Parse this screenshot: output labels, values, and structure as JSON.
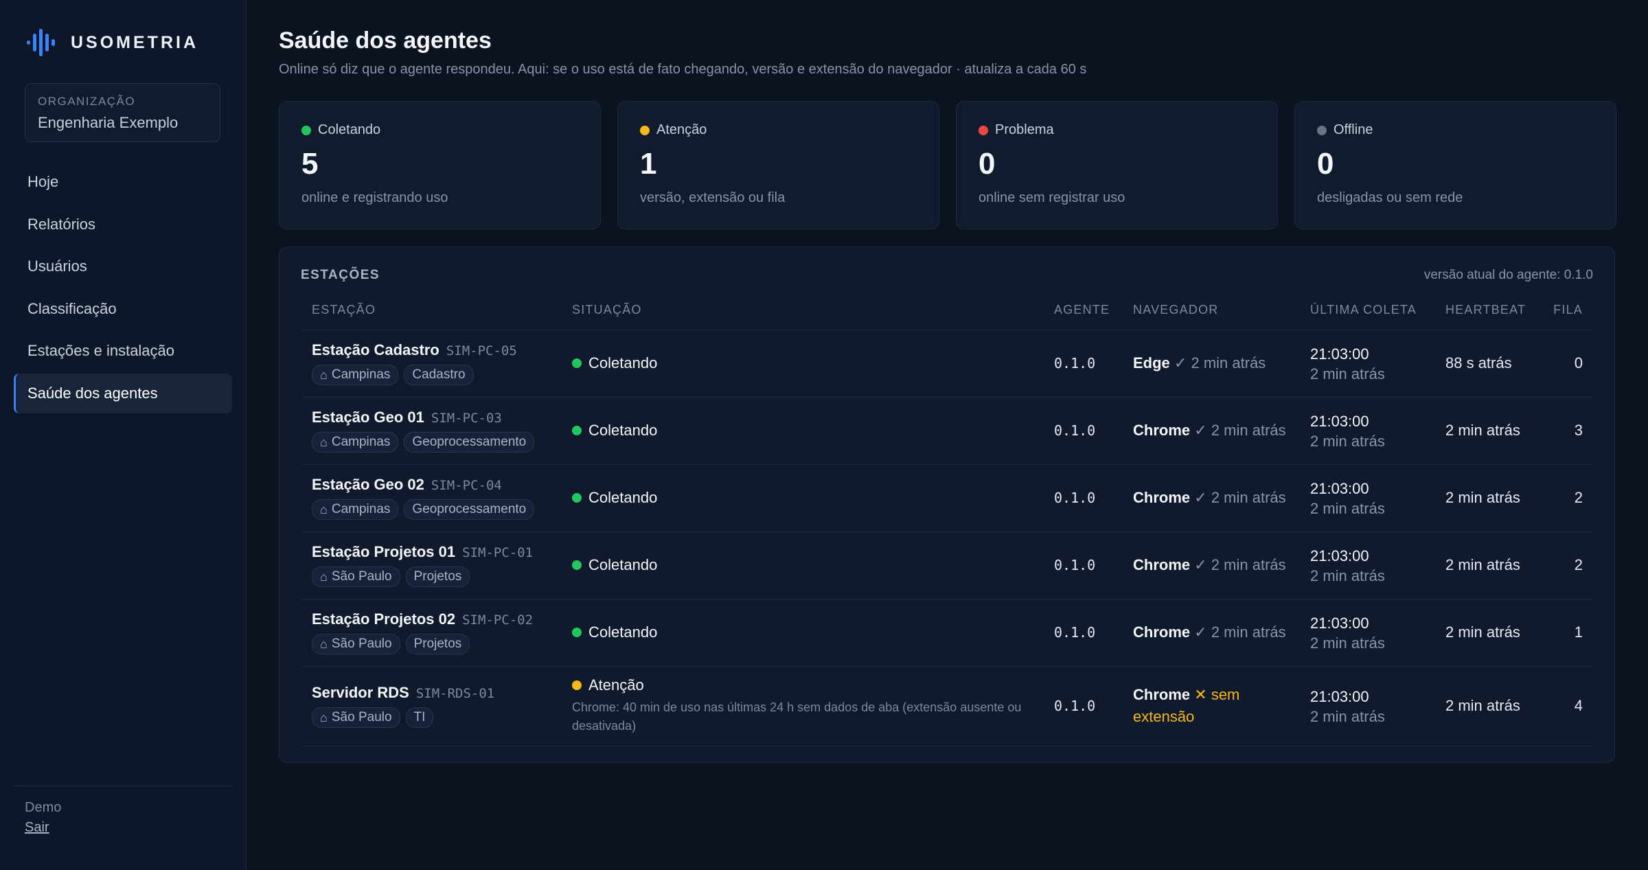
{
  "brand": {
    "name": "USOMETRIA",
    "icon": "audio-bars-icon",
    "accent": "#3b82f6"
  },
  "org": {
    "label": "ORGANIZAÇÃO",
    "name": "Engenharia Exemplo"
  },
  "nav": {
    "items": [
      {
        "label": "Hoje"
      },
      {
        "label": "Relatórios"
      },
      {
        "label": "Usuários"
      },
      {
        "label": "Classificação"
      },
      {
        "label": "Estações e instalação"
      },
      {
        "label": "Saúde dos agentes"
      }
    ],
    "active_index": 5
  },
  "footer": {
    "demo": "Demo",
    "logout": "Sair"
  },
  "page": {
    "title": "Saúde dos agentes",
    "subtitle": "Online só diz que o agente respondeu. Aqui: se o uso está de fato chegando, versão e extensão do navegador · atualiza a cada 60 s"
  },
  "cards": [
    {
      "label": "Coletando",
      "value": "5",
      "desc": "online e registrando uso",
      "color": "#22c55e"
    },
    {
      "label": "Atenção",
      "value": "1",
      "desc": "versão, extensão ou fila",
      "color": "#f5b918"
    },
    {
      "label": "Problema",
      "value": "0",
      "desc": "online sem registrar uso",
      "color": "#ef4444"
    },
    {
      "label": "Offline",
      "value": "0",
      "desc": "desligadas ou sem rede",
      "color": "#6b7280"
    }
  ],
  "table": {
    "title": "ESTAÇÕES",
    "version_note": "versão atual do agente: 0.1.0",
    "headers": {
      "station": "ESTAÇÃO",
      "status": "SITUAÇÃO",
      "agent": "AGENTE",
      "browser": "NAVEGADOR",
      "last": "ÚLTIMA COLETA",
      "heartbeat": "HEARTBEAT",
      "queue": "FILA"
    },
    "rows": [
      {
        "name": "Estação Cadastro",
        "code": "SIM-PC-05",
        "location": "Campinas",
        "dept": "Cadastro",
        "status": "Coletando",
        "status_color": "#22c55e",
        "note": "",
        "agent": "0.1.0",
        "browser": "Edge",
        "browser_mark": "✓",
        "browser_detail": "2 min atrás",
        "browser_warn": false,
        "last_time": "21:03:00",
        "last_ago": "2 min atrás",
        "heartbeat": "88 s atrás",
        "queue": "0"
      },
      {
        "name": "Estação Geo 01",
        "code": "SIM-PC-03",
        "location": "Campinas",
        "dept": "Geoprocessamento",
        "status": "Coletando",
        "status_color": "#22c55e",
        "note": "",
        "agent": "0.1.0",
        "browser": "Chrome",
        "browser_mark": "✓",
        "browser_detail": "2 min atrás",
        "browser_warn": false,
        "last_time": "21:03:00",
        "last_ago": "2 min atrás",
        "heartbeat": "2 min atrás",
        "queue": "3"
      },
      {
        "name": "Estação Geo 02",
        "code": "SIM-PC-04",
        "location": "Campinas",
        "dept": "Geoprocessamento",
        "status": "Coletando",
        "status_color": "#22c55e",
        "note": "",
        "agent": "0.1.0",
        "browser": "Chrome",
        "browser_mark": "✓",
        "browser_detail": "2 min atrás",
        "browser_warn": false,
        "last_time": "21:03:00",
        "last_ago": "2 min atrás",
        "heartbeat": "2 min atrás",
        "queue": "2"
      },
      {
        "name": "Estação Projetos 01",
        "code": "SIM-PC-01",
        "location": "São Paulo",
        "dept": "Projetos",
        "status": "Coletando",
        "status_color": "#22c55e",
        "note": "",
        "agent": "0.1.0",
        "browser": "Chrome",
        "browser_mark": "✓",
        "browser_detail": "2 min atrás",
        "browser_warn": false,
        "last_time": "21:03:00",
        "last_ago": "2 min atrás",
        "heartbeat": "2 min atrás",
        "queue": "2"
      },
      {
        "name": "Estação Projetos 02",
        "code": "SIM-PC-02",
        "location": "São Paulo",
        "dept": "Projetos",
        "status": "Coletando",
        "status_color": "#22c55e",
        "note": "",
        "agent": "0.1.0",
        "browser": "Chrome",
        "browser_mark": "✓",
        "browser_detail": "2 min atrás",
        "browser_warn": false,
        "last_time": "21:03:00",
        "last_ago": "2 min atrás",
        "heartbeat": "2 min atrás",
        "queue": "1"
      },
      {
        "name": "Servidor RDS",
        "code": "SIM-RDS-01",
        "location": "São Paulo",
        "dept": "TI",
        "status": "Atenção",
        "status_color": "#f5b918",
        "note": "Chrome: 40 min de uso nas últimas 24 h sem dados de aba (extensão ausente ou desativada)",
        "agent": "0.1.0",
        "browser": "Chrome",
        "browser_mark": "✕",
        "browser_detail": "sem extensão",
        "browser_warn": true,
        "last_time": "21:03:00",
        "last_ago": "2 min atrás",
        "heartbeat": "2 min atrás",
        "queue": "4"
      }
    ]
  }
}
